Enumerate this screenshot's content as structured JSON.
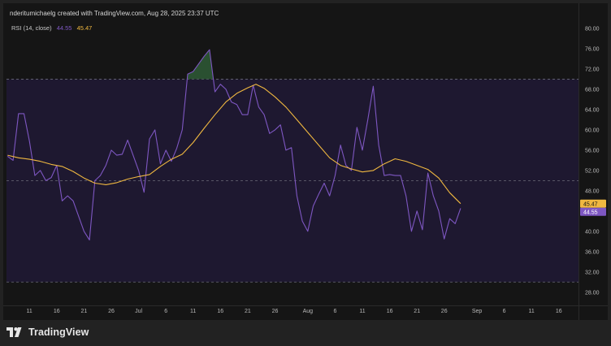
{
  "header": {
    "credit": "nderitumichaelg created with TradingView.com, Aug 28, 2025 23:37 UTC"
  },
  "legend": {
    "label": "RSI (14, close)",
    "rsi_value": "44.55",
    "ma_value": "45.47"
  },
  "footer": {
    "brand": "TradingView",
    "logo_icon": "tradingview-logo-icon"
  },
  "colors": {
    "background": "#151515",
    "band_fill": "#1e1830",
    "rsi_line": "#7e57c2",
    "ma_line": "#f0b840",
    "overbought_fill": "#2e5b36"
  },
  "chart_data": {
    "type": "line",
    "title": "RSI (14, close)",
    "ylim": [
      25.4,
      82.4
    ],
    "y_ticks": [
      "80.00",
      "76.00",
      "72.00",
      "68.00",
      "64.00",
      "60.00",
      "56.00",
      "52.00",
      "48.00",
      "40.00",
      "36.00",
      "32.00",
      "28.00"
    ],
    "x_ticks": [
      {
        "label": "11",
        "day": 11
      },
      {
        "label": "16",
        "day": 16
      },
      {
        "label": "21",
        "day": 21
      },
      {
        "label": "26",
        "day": 26
      },
      {
        "label": "Jul",
        "day": 31
      },
      {
        "label": "6",
        "day": 36
      },
      {
        "label": "11",
        "day": 41
      },
      {
        "label": "16",
        "day": 46
      },
      {
        "label": "21",
        "day": 51
      },
      {
        "label": "26",
        "day": 56
      },
      {
        "label": "Aug",
        "day": 62
      },
      {
        "label": "6",
        "day": 67
      },
      {
        "label": "11",
        "day": 72
      },
      {
        "label": "16",
        "day": 77
      },
      {
        "label": "21",
        "day": 82
      },
      {
        "label": "26",
        "day": 87
      },
      {
        "label": "Sep",
        "day": 93
      },
      {
        "label": "6",
        "day": 98
      },
      {
        "label": "11",
        "day": 103
      },
      {
        "label": "16",
        "day": 108
      }
    ],
    "x_range": [
      6.8,
      111.6
    ],
    "bands": {
      "upper": 70,
      "middle": 50,
      "lower": 30
    },
    "series": [
      {
        "name": "RSI (14, close)",
        "points": [
          [
            7.0,
            54.8
          ],
          [
            8.0,
            54.0
          ],
          [
            9.0,
            63.2
          ],
          [
            10.0,
            63.2
          ],
          [
            11.0,
            57.8
          ],
          [
            12.0,
            51.0
          ],
          [
            13.0,
            52.0
          ],
          [
            14.0,
            50.0
          ],
          [
            15.0,
            50.6
          ],
          [
            16.0,
            53.0
          ],
          [
            17.0,
            46.0
          ],
          [
            18.0,
            47.0
          ],
          [
            19.0,
            46.0
          ],
          [
            20.0,
            43.0
          ],
          [
            21.0,
            40.0
          ],
          [
            22.0,
            38.3
          ],
          [
            23.0,
            50.0
          ],
          [
            24.0,
            51.0
          ],
          [
            25.0,
            53.0
          ],
          [
            26.0,
            56.0
          ],
          [
            27.0,
            55.0
          ],
          [
            28.0,
            55.2
          ],
          [
            29.0,
            58.0
          ],
          [
            30.0,
            55.0
          ],
          [
            31.0,
            52.0
          ],
          [
            32.0,
            47.7
          ],
          [
            33.0,
            58.2
          ],
          [
            34.0,
            60.0
          ],
          [
            35.0,
            53.3
          ],
          [
            36.0,
            56.0
          ],
          [
            37.0,
            53.8
          ],
          [
            38.0,
            56.4
          ],
          [
            39.0,
            60.0
          ],
          [
            40.0,
            71.0
          ],
          [
            41.0,
            71.5
          ],
          [
            42.0,
            73.0
          ],
          [
            43.0,
            74.5
          ],
          [
            44.0,
            75.8
          ],
          [
            45.0,
            67.5
          ],
          [
            46.0,
            69.0
          ],
          [
            47.0,
            68.0
          ],
          [
            48.0,
            65.5
          ],
          [
            49.0,
            65.0
          ],
          [
            50.0,
            63.0
          ],
          [
            51.0,
            63.0
          ],
          [
            52.0,
            68.8
          ],
          [
            53.0,
            64.5
          ],
          [
            54.0,
            63.0
          ],
          [
            55.0,
            59.3
          ],
          [
            56.0,
            60.0
          ],
          [
            57.0,
            61.0
          ],
          [
            58.0,
            56.0
          ],
          [
            59.0,
            56.5
          ],
          [
            60.0,
            47.0
          ],
          [
            61.0,
            42.0
          ],
          [
            62.0,
            40.0
          ],
          [
            63.0,
            45.0
          ],
          [
            64.0,
            47.3
          ],
          [
            65.0,
            49.5
          ],
          [
            66.0,
            47.0
          ],
          [
            67.0,
            51.0
          ],
          [
            68.0,
            57.0
          ],
          [
            69.0,
            53.0
          ],
          [
            70.0,
            52.0
          ],
          [
            71.0,
            60.5
          ],
          [
            72.0,
            56.0
          ],
          [
            73.0,
            62.0
          ],
          [
            74.0,
            68.6
          ],
          [
            75.0,
            57.0
          ],
          [
            76.0,
            51.0
          ],
          [
            77.0,
            51.2
          ],
          [
            78.0,
            51.0
          ],
          [
            79.0,
            51.0
          ],
          [
            80.0,
            47.0
          ],
          [
            81.0,
            40.0
          ],
          [
            82.0,
            44.0
          ],
          [
            83.0,
            40.3
          ],
          [
            84.0,
            51.5
          ],
          [
            85.0,
            47.0
          ],
          [
            86.0,
            44.0
          ],
          [
            87.0,
            38.5
          ],
          [
            88.0,
            42.5
          ],
          [
            89.0,
            41.5
          ],
          [
            90.0,
            44.55
          ]
        ]
      },
      {
        "name": "RSI-based MA",
        "points": [
          [
            7.0,
            55.0
          ],
          [
            9.0,
            54.5
          ],
          [
            11.0,
            54.2
          ],
          [
            13.0,
            53.8
          ],
          [
            15.0,
            53.2
          ],
          [
            17.0,
            52.8
          ],
          [
            19.0,
            51.8
          ],
          [
            21.0,
            50.5
          ],
          [
            23.0,
            49.5
          ],
          [
            25.0,
            49.2
          ],
          [
            27.0,
            49.6
          ],
          [
            29.0,
            50.3
          ],
          [
            31.0,
            50.8
          ],
          [
            33.0,
            51.2
          ],
          [
            35.0,
            52.8
          ],
          [
            37.0,
            54.2
          ],
          [
            39.0,
            55.2
          ],
          [
            41.0,
            57.5
          ],
          [
            43.0,
            60.3
          ],
          [
            45.0,
            63.0
          ],
          [
            47.0,
            65.5
          ],
          [
            49.0,
            67.2
          ],
          [
            51.0,
            68.3
          ],
          [
            52.5,
            69.0
          ],
          [
            54.0,
            68.2
          ],
          [
            56.0,
            66.5
          ],
          [
            58.0,
            64.5
          ],
          [
            60.0,
            62.0
          ],
          [
            62.0,
            59.5
          ],
          [
            64.0,
            57.0
          ],
          [
            66.0,
            54.5
          ],
          [
            68.0,
            53.0
          ],
          [
            70.0,
            52.3
          ],
          [
            72.0,
            51.7
          ],
          [
            74.0,
            52.0
          ],
          [
            76.0,
            53.3
          ],
          [
            78.0,
            54.3
          ],
          [
            80.0,
            53.8
          ],
          [
            82.0,
            53.0
          ],
          [
            84.0,
            52.2
          ],
          [
            86.0,
            50.5
          ],
          [
            88.0,
            47.6
          ],
          [
            90.0,
            45.47
          ]
        ]
      }
    ],
    "price_labels": {
      "ma": "45.47",
      "rsi": "44.55"
    }
  }
}
